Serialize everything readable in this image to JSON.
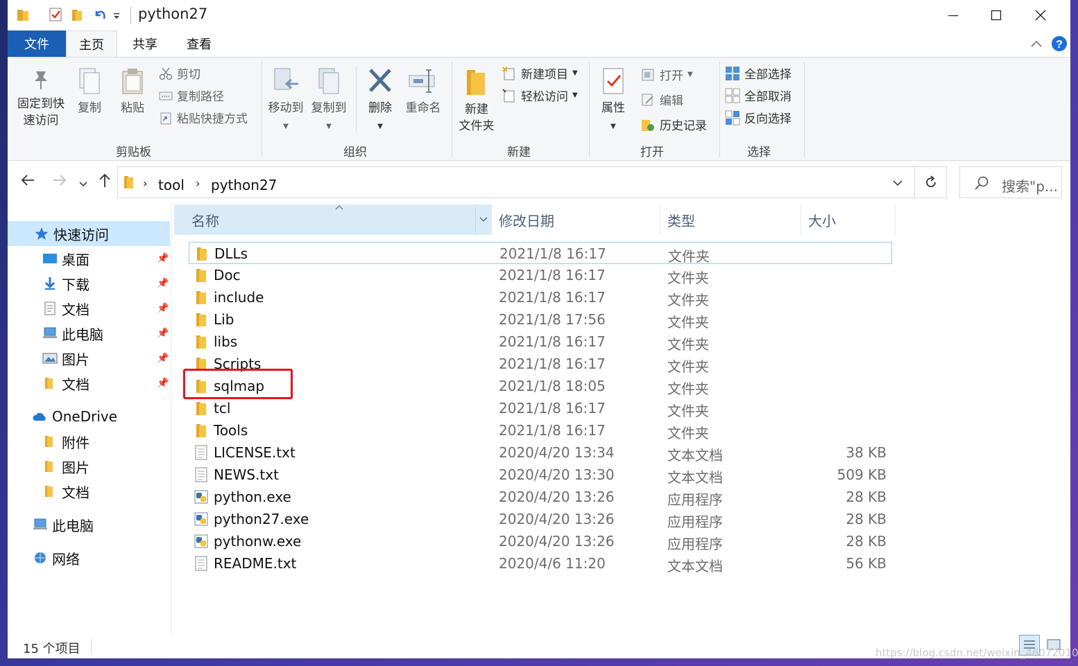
{
  "window": {
    "title": "python27"
  },
  "tabs": {
    "file": "文件",
    "home": "主页",
    "share": "共享",
    "view": "查看"
  },
  "ribbon": {
    "clipboard": {
      "label": "剪贴板",
      "pin_line1": "固定到快",
      "pin_line2": "速访问",
      "copy": "复制",
      "paste": "粘贴",
      "cut": "剪切",
      "copy_path": "复制路径",
      "paste_shortcut": "粘贴快捷方式"
    },
    "organize": {
      "label": "组织",
      "move_to": "移动到",
      "copy_to": "复制到",
      "delete": "删除",
      "rename": "重命名"
    },
    "new": {
      "label": "新建",
      "new_folder_line1": "新建",
      "new_folder_line2": "文件夹",
      "new_item": "新建项目",
      "easy_access": "轻松访问"
    },
    "open": {
      "label": "打开",
      "properties": "属性",
      "open": "打开",
      "edit": "编辑",
      "history": "历史记录"
    },
    "select": {
      "label": "选择",
      "select_all": "全部选择",
      "select_none": "全部取消",
      "invert": "反向选择"
    }
  },
  "address": {
    "crumbs": [
      "tool",
      "python27"
    ],
    "search_placeholder": "搜索\"p..."
  },
  "nav": {
    "quick_access": "快速访问",
    "qa_items": [
      "桌面",
      "下载",
      "文档",
      "此电脑",
      "图片",
      "文档"
    ],
    "onedrive": "OneDrive",
    "od_items": [
      "附件",
      "图片",
      "文档"
    ],
    "this_pc": "此电脑",
    "network": "网络"
  },
  "columns": {
    "name": "名称",
    "date": "修改日期",
    "type": "类型",
    "size": "大小"
  },
  "files": [
    {
      "name": "DLLs",
      "date": "2021/1/8 16:17",
      "type": "文件夹",
      "size": "",
      "kind": "folder"
    },
    {
      "name": "Doc",
      "date": "2021/1/8 16:17",
      "type": "文件夹",
      "size": "",
      "kind": "folder"
    },
    {
      "name": "include",
      "date": "2021/1/8 16:17",
      "type": "文件夹",
      "size": "",
      "kind": "folder"
    },
    {
      "name": "Lib",
      "date": "2021/1/8 17:56",
      "type": "文件夹",
      "size": "",
      "kind": "folder"
    },
    {
      "name": "libs",
      "date": "2021/1/8 16:17",
      "type": "文件夹",
      "size": "",
      "kind": "folder"
    },
    {
      "name": "Scripts",
      "date": "2021/1/8 16:17",
      "type": "文件夹",
      "size": "",
      "kind": "folder"
    },
    {
      "name": "sqlmap",
      "date": "2021/1/8 18:05",
      "type": "文件夹",
      "size": "",
      "kind": "folder"
    },
    {
      "name": "tcl",
      "date": "2021/1/8 16:17",
      "type": "文件夹",
      "size": "",
      "kind": "folder"
    },
    {
      "name": "Tools",
      "date": "2021/1/8 16:17",
      "type": "文件夹",
      "size": "",
      "kind": "folder"
    },
    {
      "name": "LICENSE.txt",
      "date": "2020/4/20 13:34",
      "type": "文本文档",
      "size": "38 KB",
      "kind": "txt"
    },
    {
      "name": "NEWS.txt",
      "date": "2020/4/20 13:30",
      "type": "文本文档",
      "size": "509 KB",
      "kind": "txt"
    },
    {
      "name": "python.exe",
      "date": "2020/4/20 13:26",
      "type": "应用程序",
      "size": "28 KB",
      "kind": "exe"
    },
    {
      "name": "python27.exe",
      "date": "2020/4/20 13:26",
      "type": "应用程序",
      "size": "28 KB",
      "kind": "exe"
    },
    {
      "name": "pythonw.exe",
      "date": "2020/4/20 13:26",
      "type": "应用程序",
      "size": "28 KB",
      "kind": "exe"
    },
    {
      "name": "README.txt",
      "date": "2020/4/6 11:20",
      "type": "文本文档",
      "size": "56 KB",
      "kind": "txt"
    }
  ],
  "status": {
    "count": "15 个项目"
  },
  "watermark": "https://blog.csdn.net/weixin_46072010",
  "colors": {
    "accent": "#1a5fb4",
    "folder": "#f6c343",
    "selection": "#cce8ff",
    "highlight_box": "#e8141a"
  }
}
